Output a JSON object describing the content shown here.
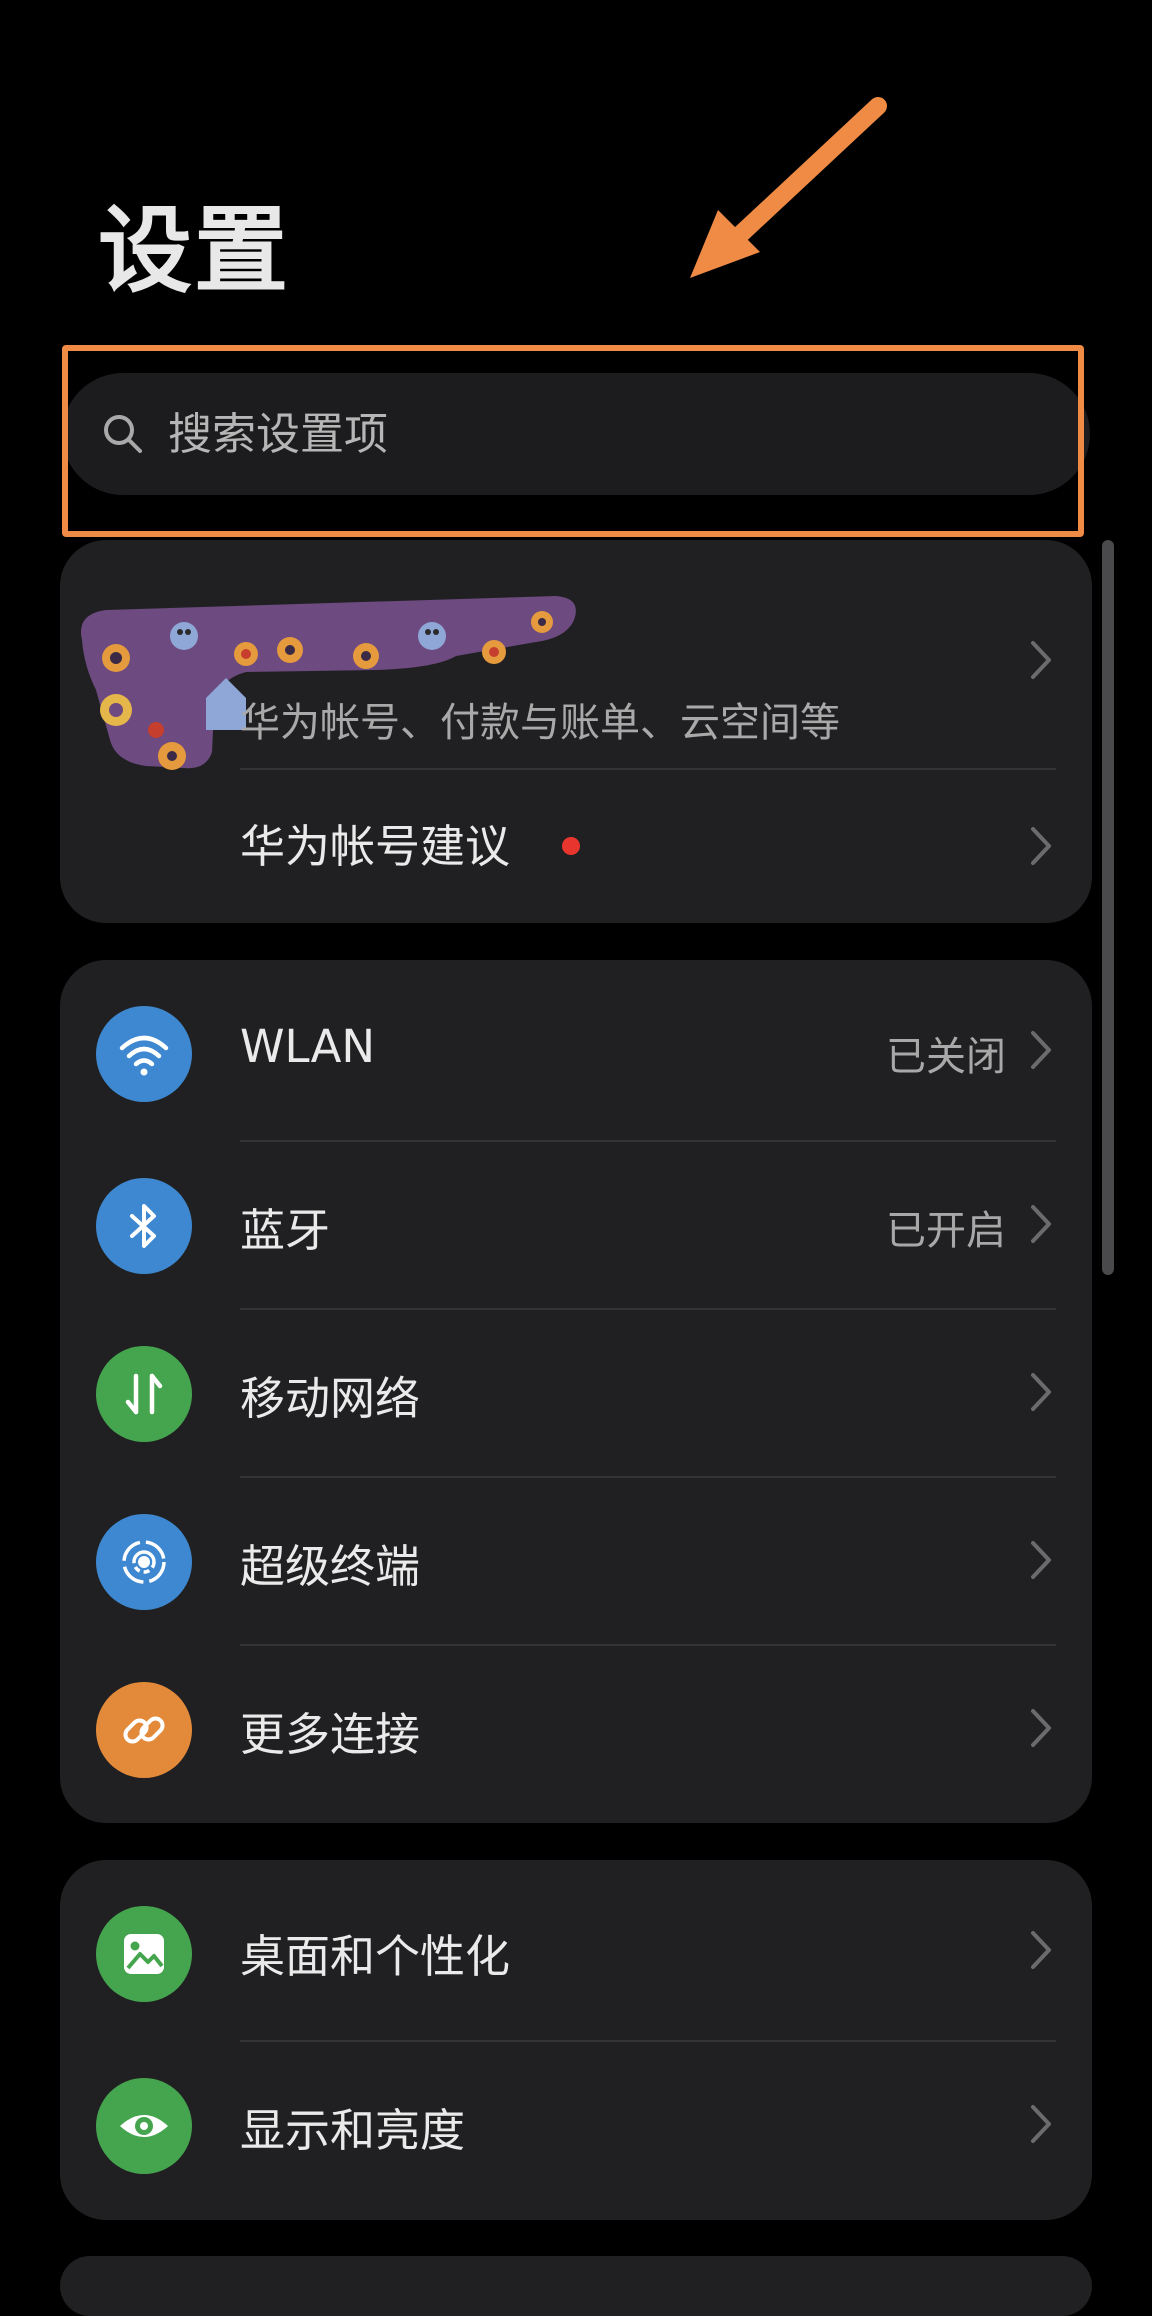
{
  "page": {
    "title": "设置"
  },
  "search": {
    "placeholder": "搜索设置项"
  },
  "account_card": {
    "subtitle": "华为帐号、付款与账单、云空间等",
    "suggestion_label": "华为帐号建议",
    "badge_color": "#e8352d"
  },
  "connectivity": {
    "items": [
      {
        "label": "WLAN",
        "value": "已关闭",
        "icon": "wifi-icon",
        "color": "#3d88d0"
      },
      {
        "label": "蓝牙",
        "value": "已开启",
        "icon": "bluetooth-icon",
        "color": "#3d88d0"
      },
      {
        "label": "移动网络",
        "value": "",
        "icon": "mobile-data-icon",
        "color": "#45a44e"
      },
      {
        "label": "超级终端",
        "value": "",
        "icon": "super-device-icon",
        "color": "#3d88d0"
      },
      {
        "label": "更多连接",
        "value": "",
        "icon": "link-icon",
        "color": "#e38a3a"
      }
    ]
  },
  "personalization": {
    "items": [
      {
        "label": "桌面和个性化",
        "icon": "wallpaper-icon",
        "color": "#45a44e"
      },
      {
        "label": "显示和亮度",
        "icon": "eye-icon",
        "color": "#45a44e"
      }
    ]
  },
  "annotation": {
    "color": "#ef8b45"
  }
}
